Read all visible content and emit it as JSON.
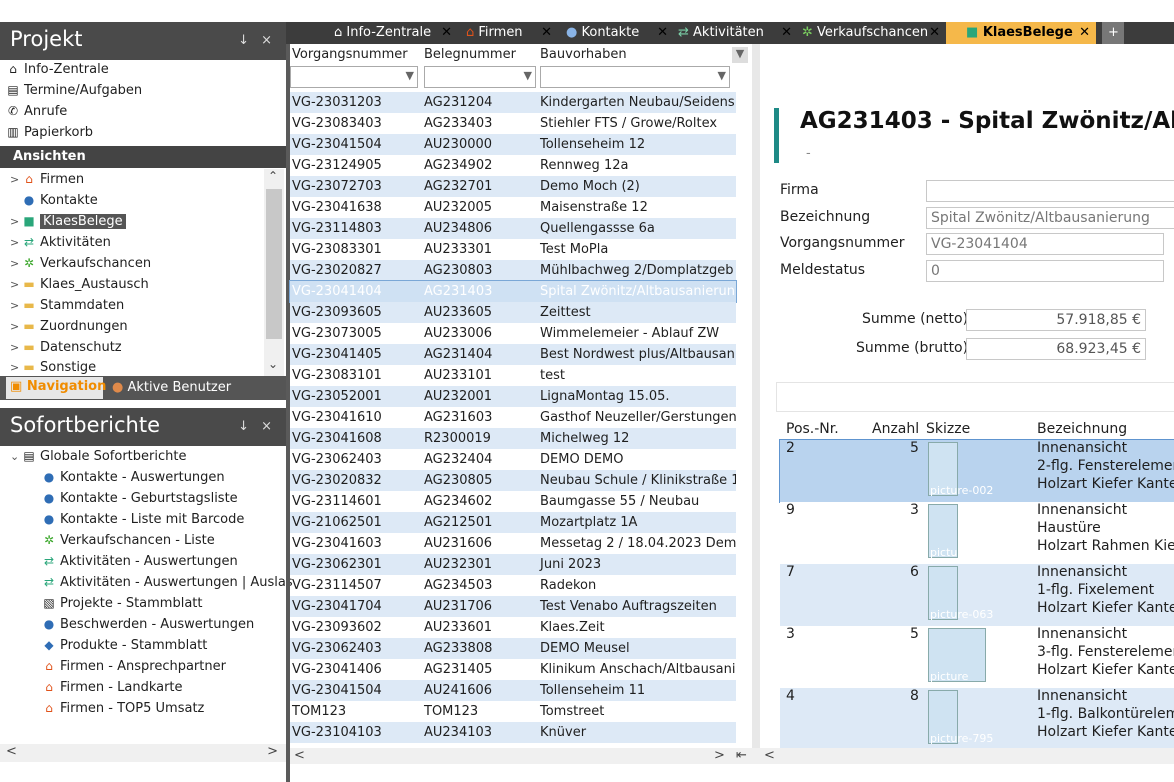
{
  "project_panel": {
    "title": "Projekt",
    "pin_label": "↓ ×",
    "top_items": [
      {
        "label": "Info-Zentrale",
        "icon": "house-icon"
      },
      {
        "label": "Termine/Aufgaben",
        "icon": "calendar-icon"
      },
      {
        "label": "Anrufe",
        "icon": "phone-icon"
      },
      {
        "label": "Papierkorb",
        "icon": "trash-icon"
      }
    ],
    "ansichten_label": "Ansichten",
    "views": [
      {
        "label": "Firmen",
        "icon": "house-icon"
      },
      {
        "label": "Kontakte",
        "icon": "people-icon"
      },
      {
        "label": "KlaesBelege",
        "icon": "square-icon"
      },
      {
        "label": "Aktivitäten",
        "icon": "arrows-icon"
      },
      {
        "label": "Verkaufschancen",
        "icon": "leaf-icon"
      },
      {
        "label": "Klaes_Austausch",
        "icon": "folder-icon"
      },
      {
        "label": "Stammdaten",
        "icon": "folder-icon"
      },
      {
        "label": "Zuordnungen",
        "icon": "folder-icon"
      },
      {
        "label": "Datenschutz",
        "icon": "folder-icon"
      },
      {
        "label": "Sonstige",
        "icon": "folder-icon"
      }
    ],
    "bottom_tabs": [
      "Navigation",
      "Aktive Benutzer"
    ]
  },
  "reports_panel": {
    "title": "Sofortberichte",
    "group": "Globale Sofortberichte",
    "items": [
      {
        "label": "Kontakte - Auswertungen",
        "icon": "people-icon"
      },
      {
        "label": "Kontakte - Geburtstagsliste",
        "icon": "people-icon"
      },
      {
        "label": "Kontakte - Liste mit Barcode",
        "icon": "people-icon"
      },
      {
        "label": "Verkaufschancen - Liste",
        "icon": "leaf-icon"
      },
      {
        "label": "Aktivitäten - Auswertungen",
        "icon": "arrows-icon"
      },
      {
        "label": "Aktivitäten - Auswertungen | Auslas",
        "icon": "arrows-icon"
      },
      {
        "label": "Projekte - Stammblatt",
        "icon": "project-icon"
      },
      {
        "label": "Beschwerden - Auswertungen",
        "icon": "people-icon"
      },
      {
        "label": "Produkte - Stammblatt",
        "icon": "cube-icon"
      },
      {
        "label": "Firmen - Ansprechpartner",
        "icon": "house-icon"
      },
      {
        "label": "Firmen - Landkarte",
        "icon": "house-icon"
      },
      {
        "label": "Firmen - TOP5 Umsatz",
        "icon": "house-icon"
      }
    ]
  },
  "tabs": [
    {
      "label": "Info-Zentrale",
      "icon": "house-icon"
    },
    {
      "label": "Firmen",
      "icon": "house-icon"
    },
    {
      "label": "Kontakte",
      "icon": "people-icon"
    },
    {
      "label": "Aktivitäten",
      "icon": "arrows-icon"
    },
    {
      "label": "Verkaufschancen",
      "icon": "leaf-icon"
    },
    {
      "label": "KlaesBelege",
      "icon": "square-icon",
      "active": true
    }
  ],
  "tab_close": "✕",
  "grid": {
    "columns": [
      "Vorgangsnummer",
      "Belegnummer",
      "Bauvorhaben"
    ],
    "rows": [
      [
        "VG-23031203",
        "AG231204",
        "Kindergarten Neubau/Seidens"
      ],
      [
        "VG-23083403",
        "AG233403",
        "Stiehler FTS / Growe/Roltex"
      ],
      [
        "VG-23041504",
        "AU230000",
        "Tollenseheim 12"
      ],
      [
        "VG-23124905",
        "AG234902",
        "Rennweg 12a"
      ],
      [
        "VG-23072703",
        "AG232701",
        "Demo Moch (2)"
      ],
      [
        "VG-23041638",
        "AU232005",
        "Maisenstraße 12"
      ],
      [
        "VG-23114803",
        "AU234806",
        "Quellengassse 6a"
      ],
      [
        "VG-23083301",
        "AU233301",
        "Test MoPla"
      ],
      [
        "VG-23020827",
        "AG230803",
        "Mühlbachweg 2/Domplatzgeb"
      ],
      [
        "VG-23041404",
        "AG231403",
        "Spital Zwönitz/Altbausanierun"
      ],
      [
        "VG-23093605",
        "AU233605",
        "Zeittest"
      ],
      [
        "VG-23073005",
        "AU233006",
        "Wimmelemeier - Ablauf ZW"
      ],
      [
        "VG-23041405",
        "AG231404",
        "Best Nordwest plus/Altbausan"
      ],
      [
        "VG-23083101",
        "AU233101",
        "test"
      ],
      [
        "VG-23052001",
        "AU232001",
        "LignaMontag 15.05."
      ],
      [
        "VG-23041610",
        "AG231603",
        "Gasthof Neuzeller/Gerstungen"
      ],
      [
        "VG-23041608",
        "R2300019",
        "Michelweg 12"
      ],
      [
        "VG-23062403",
        "AG232404",
        "DEMO DEMO"
      ],
      [
        "VG-23020832",
        "AG230805",
        "Neubau Schule / Klinikstraße 1"
      ],
      [
        "VG-23114601",
        "AG234602",
        "Baumgasse 55 / Neubau"
      ],
      [
        "VG-21062501",
        "AG212501",
        "Mozartplatz 1A"
      ],
      [
        "VG-23041603",
        "AU231606",
        "Messetag 2 / 18.04.2023 Demc"
      ],
      [
        "VG-23062301",
        "AU232301",
        "Juni 2023"
      ],
      [
        "VG-23114507",
        "AG234503",
        "Radekon"
      ],
      [
        "VG-23041704",
        "AU231706",
        "Test Venabo Auftragszeiten"
      ],
      [
        "VG-23093602",
        "AU233601",
        "Klaes.Zeit"
      ],
      [
        "VG-23062403",
        "AG233808",
        "DEMO Meusel"
      ],
      [
        "VG-23041406",
        "AG231405",
        "Klinikum Anschach/Altbausani"
      ],
      [
        "VG-23041504",
        "AU241606",
        "Tollenseheim 11"
      ],
      [
        "TOM123",
        "TOM123",
        "Tomstreet"
      ],
      [
        "VG-23104103",
        "AU234103",
        "Knüver"
      ]
    ],
    "selected_index": 9
  },
  "detail": {
    "heading": "AG231403 - Spital Zwönitz/Alt",
    "sub": "-",
    "fields": [
      {
        "label": "Firma",
        "value": ""
      },
      {
        "label": "Bezeichnung",
        "value": "Spital Zwönitz/Altbausanierung"
      },
      {
        "label": "Vorgangsnummer",
        "value": "VG-23041404"
      },
      {
        "label": "Meldestatus",
        "value": "0"
      }
    ],
    "sums": [
      {
        "label": "Summe (netto)",
        "value": "57.918,85 €"
      },
      {
        "label": "Summe (brutto)",
        "value": "68.923,45 €"
      }
    ],
    "pos_columns": [
      "Pos.-Nr.",
      "Anzahl",
      "Skizze",
      "Bezeichnung"
    ],
    "positions": [
      {
        "pos": "2",
        "qty": "5",
        "thumb": "picture-002",
        "lines": [
          "Innenansicht",
          "2-flg. Fensterelemer",
          "Holzart Kiefer Kante"
        ]
      },
      {
        "pos": "9",
        "qty": "3",
        "thumb": "picture",
        "lines": [
          "Innenansicht",
          "Haustüre",
          "Holzart Rahmen  Kie"
        ]
      },
      {
        "pos": "7",
        "qty": "6",
        "thumb": "picture-063",
        "lines": [
          "Innenansicht",
          "1-flg. Fixelement",
          "Holzart Kiefer Kante"
        ]
      },
      {
        "pos": "3",
        "qty": "5",
        "thumb": "picture",
        "lines": [
          "Innenansicht",
          "3-flg. Fensterelemer",
          "Holzart Kiefer Kante"
        ]
      },
      {
        "pos": "4",
        "qty": "8",
        "thumb": "picture-795",
        "lines": [
          "Innenansicht",
          "1-flg. Balkontürelem",
          "Holzart Kiefer Kante"
        ]
      }
    ]
  },
  "colors": {
    "accent": "#f08c00",
    "selection": "#cfe1f3",
    "alt_row": "#dde9f6",
    "title_bar": "#4a4a4a",
    "teal_bar": "#1e8a86"
  }
}
